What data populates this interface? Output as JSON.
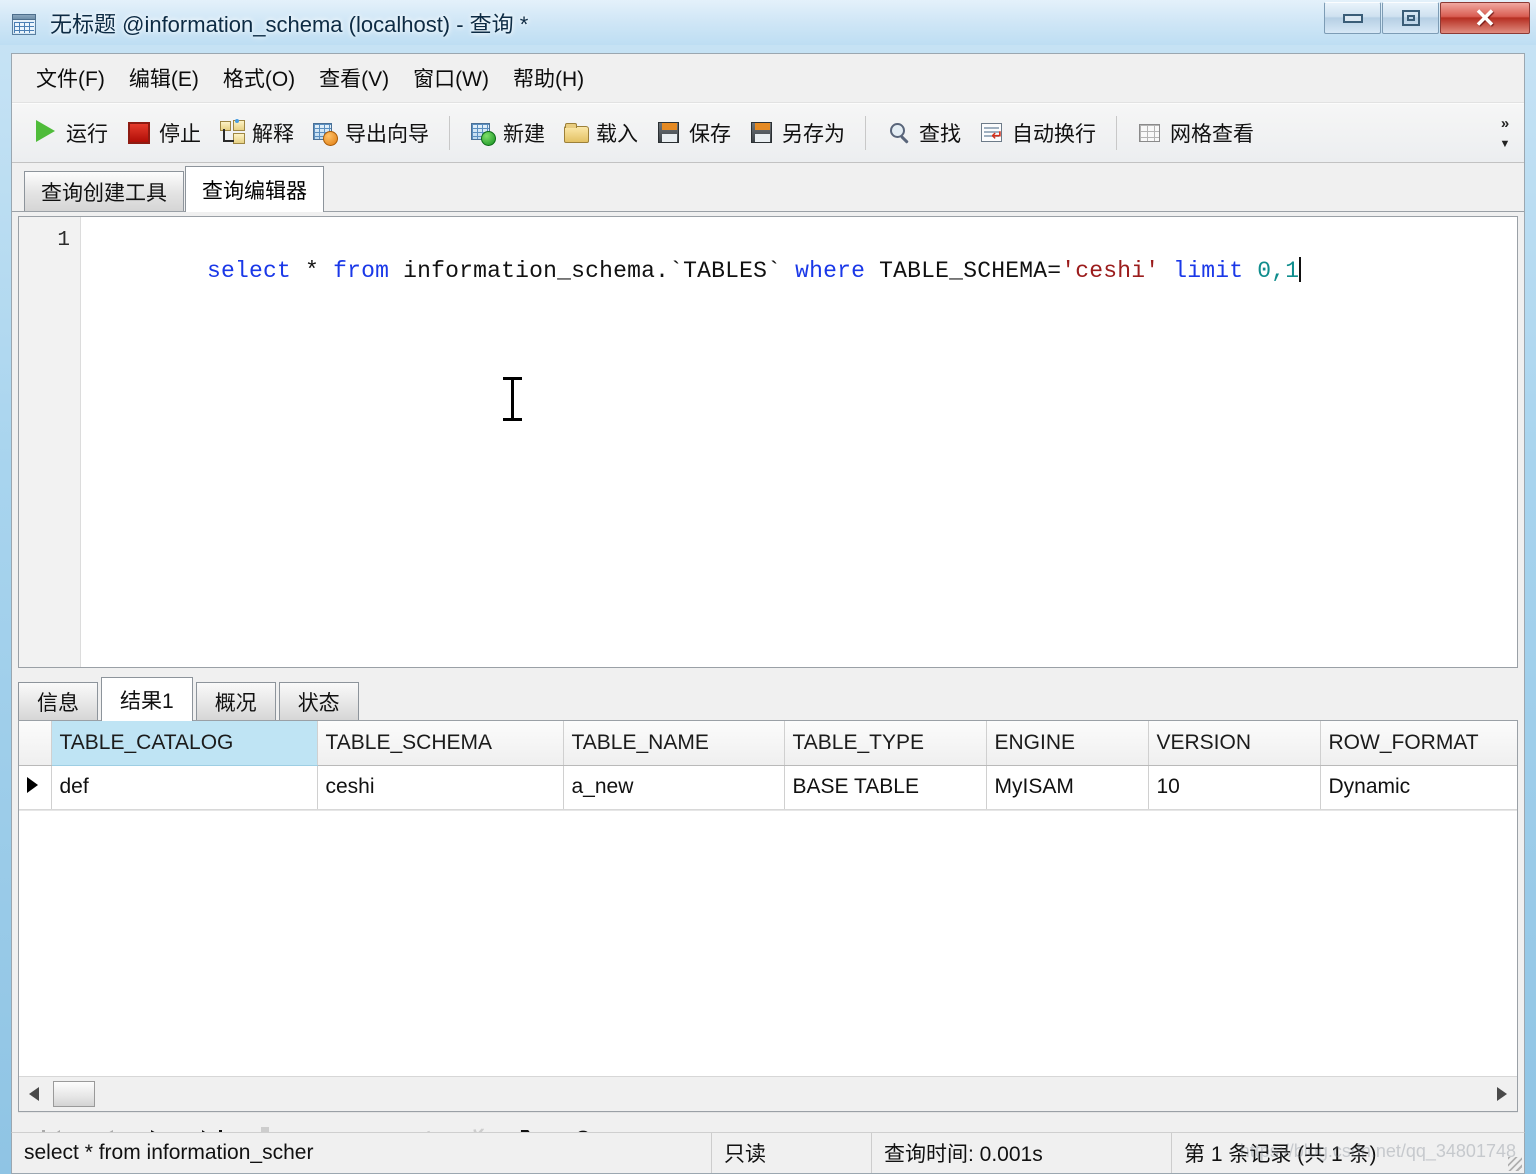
{
  "window": {
    "title": "无标题 @information_schema (localhost) - 查询 *",
    "icon": "table-window-icon",
    "controls": {
      "minimize": "minimize-button",
      "maximize": "maximize-button",
      "close_glyph": "✕"
    }
  },
  "menu": {
    "items": [
      {
        "label": "文件(F)",
        "name": "menu-file"
      },
      {
        "label": "编辑(E)",
        "name": "menu-edit"
      },
      {
        "label": "格式(O)",
        "name": "menu-format"
      },
      {
        "label": "查看(V)",
        "name": "menu-view"
      },
      {
        "label": "窗口(W)",
        "name": "menu-window"
      },
      {
        "label": "帮助(H)",
        "name": "menu-help"
      }
    ]
  },
  "toolbar": {
    "run": "运行",
    "stop": "停止",
    "explain": "解释",
    "export_wizard": "导出向导",
    "new": "新建",
    "load": "载入",
    "save": "保存",
    "save_as": "另存为",
    "find": "查找",
    "word_wrap": "自动换行",
    "grid_view": "网格查看",
    "overflow_glyph": "»",
    "overflow_down_glyph": "▼"
  },
  "query_tabs": [
    {
      "label": "查询创建工具",
      "active": false
    },
    {
      "label": "查询编辑器",
      "active": true
    }
  ],
  "editor": {
    "line_number": "1",
    "sql_tokens": [
      {
        "t": "select",
        "c": "kw"
      },
      {
        "t": " * ",
        "c": ""
      },
      {
        "t": "from",
        "c": "kw"
      },
      {
        "t": " information_schema.`TABLES` ",
        "c": ""
      },
      {
        "t": "where",
        "c": "kw"
      },
      {
        "t": " TABLE_SCHEMA=",
        "c": ""
      },
      {
        "t": "'ceshi'",
        "c": "str"
      },
      {
        "t": " ",
        "c": ""
      },
      {
        "t": "limit",
        "c": "kw"
      },
      {
        "t": " ",
        "c": ""
      },
      {
        "t": "0,1",
        "c": "num"
      }
    ],
    "sql_plain": "select * from information_schema.`TABLES` where TABLE_SCHEMA='ceshi' limit 0,1"
  },
  "result_tabs": [
    {
      "label": "信息",
      "active": false
    },
    {
      "label": "结果1",
      "active": true
    },
    {
      "label": "概况",
      "active": false
    },
    {
      "label": "状态",
      "active": false
    }
  ],
  "grid": {
    "columns": [
      {
        "label": "TABLE_CATALOG",
        "selected": true
      },
      {
        "label": "TABLE_SCHEMA",
        "selected": false
      },
      {
        "label": "TABLE_NAME",
        "selected": false
      },
      {
        "label": "TABLE_TYPE",
        "selected": false
      },
      {
        "label": "ENGINE",
        "selected": false
      },
      {
        "label": "VERSION",
        "selected": false
      },
      {
        "label": "ROW_FORMAT",
        "selected": false
      }
    ],
    "rows": [
      [
        "def",
        "ceshi",
        "a_new",
        "BASE TABLE",
        "MyISAM",
        "10",
        "Dynamic"
      ]
    ]
  },
  "nav_buttons": [
    {
      "name": "first-record-button",
      "enabled": false
    },
    {
      "name": "previous-record-button",
      "enabled": false
    },
    {
      "name": "next-record-button",
      "enabled": true
    },
    {
      "name": "last-record-button",
      "enabled": true
    },
    {
      "name": "add-record-button",
      "enabled": false
    },
    {
      "name": "delete-record-button",
      "enabled": false
    },
    {
      "name": "edit-record-button",
      "enabled": false
    },
    {
      "name": "confirm-edit-button",
      "enabled": false
    },
    {
      "name": "cancel-edit-button",
      "enabled": false
    },
    {
      "name": "refresh-button",
      "enabled": true
    },
    {
      "name": "stop-button",
      "enabled": true
    }
  ],
  "nav_glyphs": {
    "confirm": "✓",
    "cancel": "✗",
    "refresh": "↻",
    "stop": "⊘"
  },
  "statusbar": {
    "sql_preview": "select * from information_scher",
    "read_only": "只读",
    "query_time": "查询时间: 0.001s",
    "record_count": "第 1 条记录 (共 1 条)",
    "watermark": "https://blog.csdn.net/qq_34801748"
  },
  "scrollbar": {
    "left_arrow": "◀",
    "right_arrow": "▶"
  }
}
